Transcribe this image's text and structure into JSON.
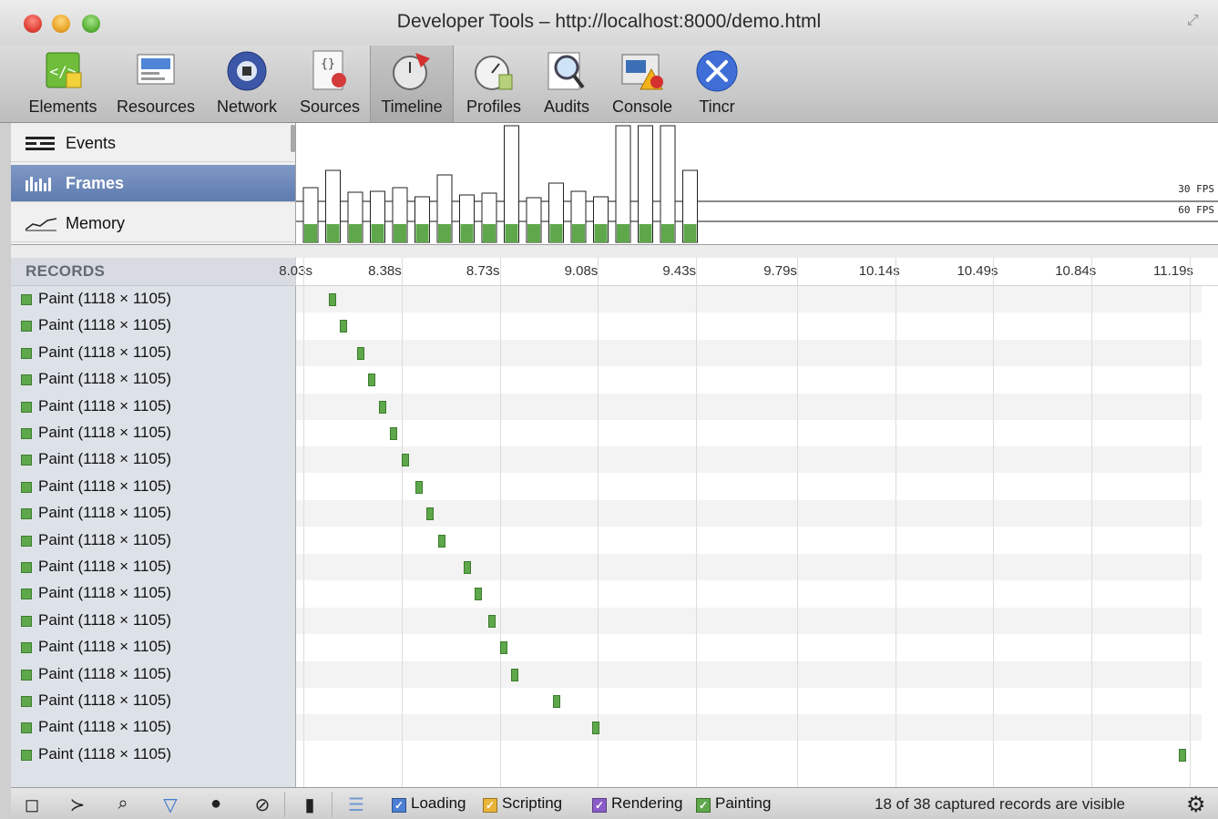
{
  "window": {
    "title": "Developer Tools – http://localhost:8000/demo.html"
  },
  "toolbar": {
    "items": [
      {
        "label": "Elements",
        "icon": "elements-icon"
      },
      {
        "label": "Resources",
        "icon": "resources-icon"
      },
      {
        "label": "Network",
        "icon": "network-icon"
      },
      {
        "label": "Sources",
        "icon": "sources-icon"
      },
      {
        "label": "Timeline",
        "icon": "timeline-icon",
        "selected": true
      },
      {
        "label": "Profiles",
        "icon": "profiles-icon"
      },
      {
        "label": "Audits",
        "icon": "audits-icon"
      },
      {
        "label": "Console",
        "icon": "console-icon"
      },
      {
        "label": "Tincr",
        "icon": "tincr-icon"
      }
    ]
  },
  "overview": {
    "modes": [
      {
        "label": "Events",
        "icon": "events-icon"
      },
      {
        "label": "Frames",
        "icon": "frames-icon",
        "selected": true
      },
      {
        "label": "Memory",
        "icon": "memory-icon"
      }
    ],
    "fps_labels": [
      "30 FPS",
      "60 FPS"
    ],
    "frame_bars_relative_height": [
      0.47,
      0.62,
      0.43,
      0.44,
      0.47,
      0.39,
      0.58,
      0.41,
      0.42,
      1.0,
      0.38,
      0.51,
      0.44,
      0.39,
      1.0,
      1.0,
      1.0,
      0.62
    ]
  },
  "records": {
    "header": "RECORDS",
    "ticks": [
      "8.03s",
      "8.38s",
      "8.73s",
      "9.08s",
      "9.43s",
      "9.79s",
      "10.14s",
      "10.49s",
      "10.84s",
      "11.19s"
    ],
    "items": [
      {
        "label": "Paint",
        "dims": "(1118 × 1105)",
        "time_s": 8.12
      },
      {
        "label": "Paint",
        "dims": "(1118 × 1105)",
        "time_s": 8.16
      },
      {
        "label": "Paint",
        "dims": "(1118 × 1105)",
        "time_s": 8.22
      },
      {
        "label": "Paint",
        "dims": "(1118 × 1105)",
        "time_s": 8.26
      },
      {
        "label": "Paint",
        "dims": "(1118 × 1105)",
        "time_s": 8.3
      },
      {
        "label": "Paint",
        "dims": "(1118 × 1105)",
        "time_s": 8.34
      },
      {
        "label": "Paint",
        "dims": "(1118 × 1105)",
        "time_s": 8.38
      },
      {
        "label": "Paint",
        "dims": "(1118 × 1105)",
        "time_s": 8.43
      },
      {
        "label": "Paint",
        "dims": "(1118 × 1105)",
        "time_s": 8.47
      },
      {
        "label": "Paint",
        "dims": "(1118 × 1105)",
        "time_s": 8.51
      },
      {
        "label": "Paint",
        "dims": "(1118 × 1105)",
        "time_s": 8.6
      },
      {
        "label": "Paint",
        "dims": "(1118 × 1105)",
        "time_s": 8.64
      },
      {
        "label": "Paint",
        "dims": "(1118 × 1105)",
        "time_s": 8.69
      },
      {
        "label": "Paint",
        "dims": "(1118 × 1105)",
        "time_s": 8.73
      },
      {
        "label": "Paint",
        "dims": "(1118 × 1105)",
        "time_s": 8.77
      },
      {
        "label": "Paint",
        "dims": "(1118 × 1105)",
        "time_s": 8.92
      },
      {
        "label": "Paint",
        "dims": "(1118 × 1105)",
        "time_s": 9.06
      },
      {
        "label": "Paint",
        "dims": "(1118 × 1105)",
        "time_s": 11.15
      }
    ]
  },
  "statusbar": {
    "filters": [
      {
        "label": "Loading",
        "color": "#4a7fd4",
        "checked": true
      },
      {
        "label": "Scripting",
        "color": "#e8b43a",
        "checked": true
      },
      {
        "label": "Rendering",
        "color": "#8a5cc8",
        "checked": true
      },
      {
        "label": "Painting",
        "color": "#5ea84b",
        "checked": true
      }
    ],
    "status": "18 of 38 captured records are visible",
    "buttons": [
      "dock-icon",
      "console-toggle-icon",
      "search-icon",
      "filter-icon",
      "record-icon",
      "clear-icon",
      "garbage-collect-icon",
      "glue-records-icon"
    ]
  },
  "colors": {
    "paint": "#5ea84b",
    "selected_mode": "#6a86b8",
    "window_border": "#c49490"
  }
}
